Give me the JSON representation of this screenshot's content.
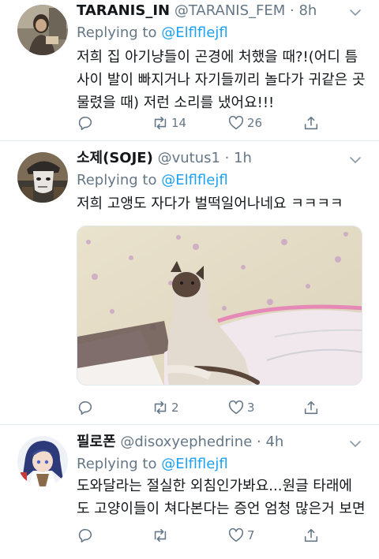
{
  "reply_prefix": "Replying to",
  "tweets": [
    {
      "name": "TARANIS_IN",
      "handle": "@TARANIS_FEM",
      "time": "8h",
      "reply_to": "@Elflflejfl",
      "text_lines": [
        "저희 집 아기냥들이 곤경에 처했을 때?!(어디 틈",
        "사이 발이 빠지거나 자기들끼리 놀다가 귀같은 곳",
        "물렸을 때) 저런 소리를 냈어요!!!"
      ],
      "replies": "",
      "retweets": "14",
      "likes": "26"
    },
    {
      "name": "소제(SOJE)",
      "handle": "@vutus1",
      "time": "1h",
      "reply_to": "@Elflflejfl",
      "text_lines": [
        "저희 고앵도 자다가 벌떡일어나네요 ㅋㅋㅋㅋ"
      ],
      "replies": "",
      "retweets": "2",
      "likes": "3",
      "media": "photo-siamese-cat"
    },
    {
      "name": "필로폰",
      "handle": "@disoxyephedrine",
      "time": "4h",
      "reply_to": "@Elflflejfl",
      "text_lines": [
        "도와달라는 절실한 외침인가봐요...원글 타래에",
        "도 고양이들이 쳐다본다는 증언 엄청 많은거 보면"
      ],
      "replies": "",
      "retweets": "",
      "likes": "7"
    }
  ],
  "icons": {
    "reply": "reply-icon",
    "retweet": "retweet-icon",
    "like": "heart-icon",
    "share": "share-icon",
    "caret": "chevron-down-icon"
  },
  "colors": {
    "link": "#1da1f2",
    "meta": "#657786",
    "text": "#14171a",
    "divider": "#e1e8ed"
  }
}
